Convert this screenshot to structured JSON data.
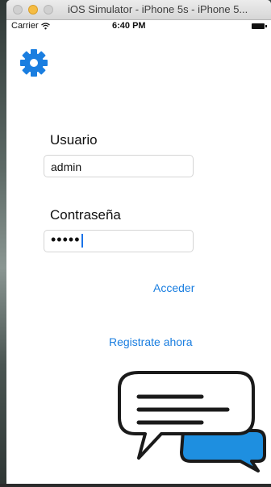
{
  "window": {
    "title": "iOS Simulator - iPhone 5s - iPhone 5..."
  },
  "status_bar": {
    "carrier": "Carrier",
    "time": "6:40 PM"
  },
  "login": {
    "username_label": "Usuario",
    "username_value": "admin",
    "password_label": "Contraseña",
    "password_value": "•••••",
    "login_link": "Acceder",
    "register_link": "Registrate ahora"
  },
  "icons": {
    "settings": "gear-icon",
    "chat": "chat-bubbles-icon",
    "wifi": "wifi-icon",
    "battery": "battery-icon"
  },
  "colors": {
    "accent": "#1a7ee0",
    "chat_blue": "#1e8fe0"
  }
}
